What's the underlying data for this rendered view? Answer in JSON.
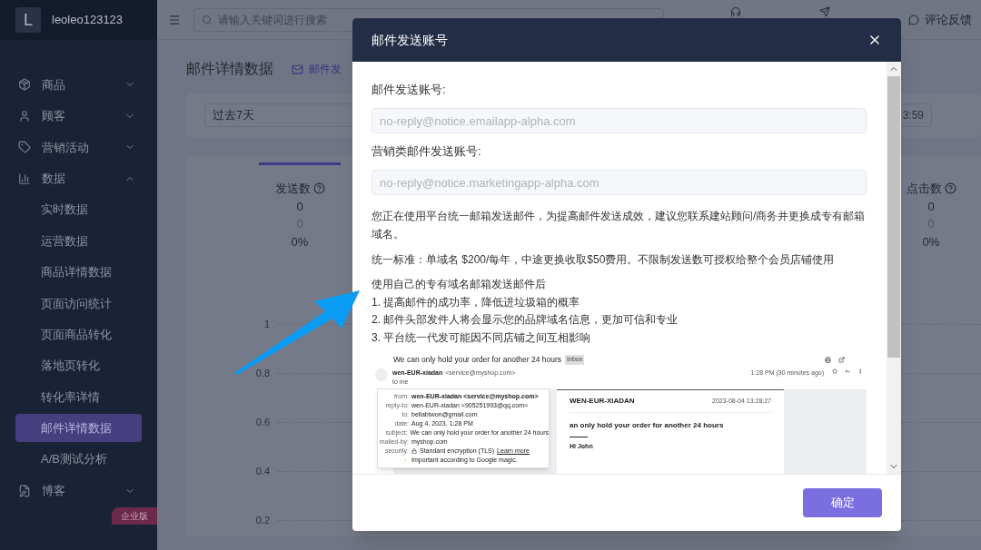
{
  "sidebar": {
    "user": {
      "initial": "L",
      "name": "leoleo123123"
    },
    "items": [
      {
        "label": "商品",
        "kind": "package",
        "expanded": false
      },
      {
        "label": "顾客",
        "kind": "user",
        "expanded": false
      },
      {
        "label": "营销活动",
        "kind": "tag",
        "expanded": false
      },
      {
        "label": "数据",
        "kind": "chart",
        "expanded": true,
        "children": [
          {
            "label": "实时数据",
            "selected": false
          },
          {
            "label": "运营数据",
            "selected": false
          },
          {
            "label": "商品详情数据",
            "selected": false
          },
          {
            "label": "页面访问统计",
            "selected": false
          },
          {
            "label": "页面商品转化",
            "selected": false
          },
          {
            "label": "落地页转化",
            "selected": false
          },
          {
            "label": "转化率详情",
            "selected": false
          },
          {
            "label": "邮件详情数据",
            "selected": true
          },
          {
            "label": "A/B测试分析",
            "selected": false
          }
        ]
      },
      {
        "label": "博客",
        "kind": "blog",
        "expanded": false
      }
    ],
    "badge": "企业版"
  },
  "header": {
    "search": {
      "placeholder": "请输入关键词进行搜索"
    },
    "actions": [
      {
        "kind": "support"
      },
      {
        "kind": "guide"
      },
      {
        "label": "评论反馈",
        "kind": "feedback"
      }
    ]
  },
  "page": {
    "title": "邮件详情数据",
    "link": "邮件发",
    "date_range": "过去7天",
    "date_end": "3:59",
    "stats": [
      {
        "label": "发送数",
        "value": "0",
        "previous": "0",
        "change": "0%",
        "selected": true
      },
      {
        "label": "点击数",
        "value": "0",
        "previous": "0",
        "change": "0%",
        "selected": false
      }
    ],
    "axis_ticks": [
      "1",
      "0.8",
      "0.6",
      "0.4",
      "0.2"
    ]
  },
  "dialog": {
    "title": "邮件发送账号",
    "fields": [
      {
        "label": "邮件发送账号:",
        "value": "no-reply@notice.emailapp-alpha.com",
        "disabled": true
      },
      {
        "label": "营销类邮件发送账号:",
        "value": "no-reply@notice.marketingapp-alpha.com",
        "disabled": true
      }
    ],
    "notice": "您正在使用平台统一邮箱发送邮件，为提高邮件发送成效，建议您联系建站顾问/商务并更换成专有邮箱域名。",
    "pricing": "统一标准：单域名 $200/每年，中途更换收取$50费用。不限制发送数可授权给整个会员店铺使用",
    "benefits": [
      "使用自己的专有域名邮箱发送邮件后",
      "1. 提高邮件的成功率，降低进垃圾箱的概率",
      "2. 邮件头部发件人将会显示您的品牌域名信息，更加可信和专业",
      "3. 平台统一代发可能因不同店铺之间互相影响"
    ],
    "example": {
      "subject": "We can only hold your order for another 24 hours",
      "label": "Inbox",
      "sender": "wen-EUR-xiadan",
      "sender_email": "<service@myshop.com>",
      "recipient": "to me",
      "time": "1:28 PM (30 minutes ago)",
      "details": [
        {
          "key": "from:",
          "value": "wen-EUR-xiadan <service@myshop.com>"
        },
        {
          "key": "reply-to:",
          "value": "wen-EUR-xiadan <905251993@qq.com>"
        },
        {
          "key": "to:",
          "value": "bellabtwon@gmail.com"
        },
        {
          "key": "date:",
          "value": "Aug 4, 2023, 1:28 PM"
        },
        {
          "key": "subject:",
          "value": "We can only hold your order for another 24 hours"
        },
        {
          "key": "mailed-by:",
          "value": "myshop.com"
        },
        {
          "key": "security:",
          "value": "Standard encryption (TLS)",
          "link": "Learn more"
        },
        {
          "value": "Important according to Google magic."
        }
      ],
      "store": "WEN-EUR-XIADAN",
      "store_time": "2023-08-04 13:28:27",
      "headline": "an only hold your order for another 24 hours",
      "greeting": "Hi John"
    },
    "confirm": "确定"
  }
}
